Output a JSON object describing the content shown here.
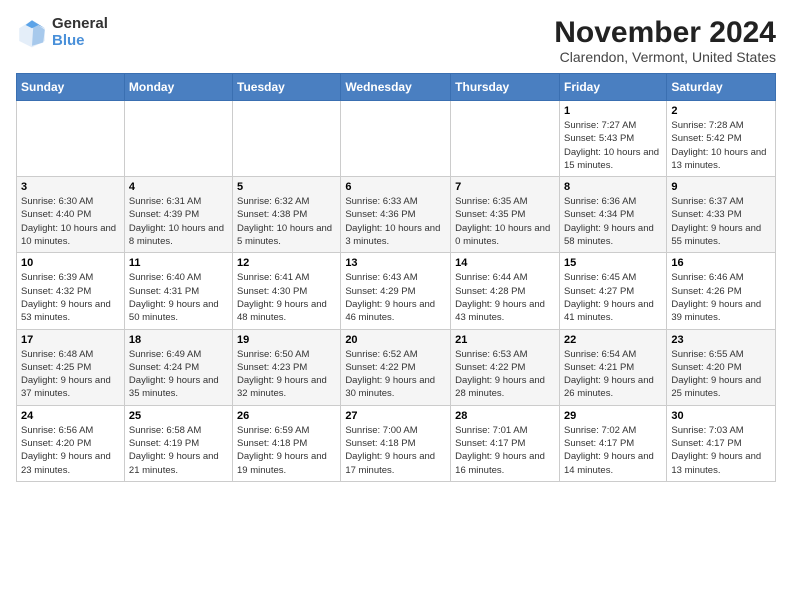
{
  "header": {
    "logo": {
      "general": "General",
      "blue": "Blue"
    },
    "title": "November 2024",
    "subtitle": "Clarendon, Vermont, United States"
  },
  "calendar": {
    "weekdays": [
      "Sunday",
      "Monday",
      "Tuesday",
      "Wednesday",
      "Thursday",
      "Friday",
      "Saturday"
    ],
    "weeks": [
      [
        {
          "day": "",
          "info": ""
        },
        {
          "day": "",
          "info": ""
        },
        {
          "day": "",
          "info": ""
        },
        {
          "day": "",
          "info": ""
        },
        {
          "day": "",
          "info": ""
        },
        {
          "day": "1",
          "info": "Sunrise: 7:27 AM\nSunset: 5:43 PM\nDaylight: 10 hours and 15 minutes."
        },
        {
          "day": "2",
          "info": "Sunrise: 7:28 AM\nSunset: 5:42 PM\nDaylight: 10 hours and 13 minutes."
        }
      ],
      [
        {
          "day": "3",
          "info": "Sunrise: 6:30 AM\nSunset: 4:40 PM\nDaylight: 10 hours and 10 minutes."
        },
        {
          "day": "4",
          "info": "Sunrise: 6:31 AM\nSunset: 4:39 PM\nDaylight: 10 hours and 8 minutes."
        },
        {
          "day": "5",
          "info": "Sunrise: 6:32 AM\nSunset: 4:38 PM\nDaylight: 10 hours and 5 minutes."
        },
        {
          "day": "6",
          "info": "Sunrise: 6:33 AM\nSunset: 4:36 PM\nDaylight: 10 hours and 3 minutes."
        },
        {
          "day": "7",
          "info": "Sunrise: 6:35 AM\nSunset: 4:35 PM\nDaylight: 10 hours and 0 minutes."
        },
        {
          "day": "8",
          "info": "Sunrise: 6:36 AM\nSunset: 4:34 PM\nDaylight: 9 hours and 58 minutes."
        },
        {
          "day": "9",
          "info": "Sunrise: 6:37 AM\nSunset: 4:33 PM\nDaylight: 9 hours and 55 minutes."
        }
      ],
      [
        {
          "day": "10",
          "info": "Sunrise: 6:39 AM\nSunset: 4:32 PM\nDaylight: 9 hours and 53 minutes."
        },
        {
          "day": "11",
          "info": "Sunrise: 6:40 AM\nSunset: 4:31 PM\nDaylight: 9 hours and 50 minutes."
        },
        {
          "day": "12",
          "info": "Sunrise: 6:41 AM\nSunset: 4:30 PM\nDaylight: 9 hours and 48 minutes."
        },
        {
          "day": "13",
          "info": "Sunrise: 6:43 AM\nSunset: 4:29 PM\nDaylight: 9 hours and 46 minutes."
        },
        {
          "day": "14",
          "info": "Sunrise: 6:44 AM\nSunset: 4:28 PM\nDaylight: 9 hours and 43 minutes."
        },
        {
          "day": "15",
          "info": "Sunrise: 6:45 AM\nSunset: 4:27 PM\nDaylight: 9 hours and 41 minutes."
        },
        {
          "day": "16",
          "info": "Sunrise: 6:46 AM\nSunset: 4:26 PM\nDaylight: 9 hours and 39 minutes."
        }
      ],
      [
        {
          "day": "17",
          "info": "Sunrise: 6:48 AM\nSunset: 4:25 PM\nDaylight: 9 hours and 37 minutes."
        },
        {
          "day": "18",
          "info": "Sunrise: 6:49 AM\nSunset: 4:24 PM\nDaylight: 9 hours and 35 minutes."
        },
        {
          "day": "19",
          "info": "Sunrise: 6:50 AM\nSunset: 4:23 PM\nDaylight: 9 hours and 32 minutes."
        },
        {
          "day": "20",
          "info": "Sunrise: 6:52 AM\nSunset: 4:22 PM\nDaylight: 9 hours and 30 minutes."
        },
        {
          "day": "21",
          "info": "Sunrise: 6:53 AM\nSunset: 4:22 PM\nDaylight: 9 hours and 28 minutes."
        },
        {
          "day": "22",
          "info": "Sunrise: 6:54 AM\nSunset: 4:21 PM\nDaylight: 9 hours and 26 minutes."
        },
        {
          "day": "23",
          "info": "Sunrise: 6:55 AM\nSunset: 4:20 PM\nDaylight: 9 hours and 25 minutes."
        }
      ],
      [
        {
          "day": "24",
          "info": "Sunrise: 6:56 AM\nSunset: 4:20 PM\nDaylight: 9 hours and 23 minutes."
        },
        {
          "day": "25",
          "info": "Sunrise: 6:58 AM\nSunset: 4:19 PM\nDaylight: 9 hours and 21 minutes."
        },
        {
          "day": "26",
          "info": "Sunrise: 6:59 AM\nSunset: 4:18 PM\nDaylight: 9 hours and 19 minutes."
        },
        {
          "day": "27",
          "info": "Sunrise: 7:00 AM\nSunset: 4:18 PM\nDaylight: 9 hours and 17 minutes."
        },
        {
          "day": "28",
          "info": "Sunrise: 7:01 AM\nSunset: 4:17 PM\nDaylight: 9 hours and 16 minutes."
        },
        {
          "day": "29",
          "info": "Sunrise: 7:02 AM\nSunset: 4:17 PM\nDaylight: 9 hours and 14 minutes."
        },
        {
          "day": "30",
          "info": "Sunrise: 7:03 AM\nSunset: 4:17 PM\nDaylight: 9 hours and 13 minutes."
        }
      ]
    ]
  }
}
